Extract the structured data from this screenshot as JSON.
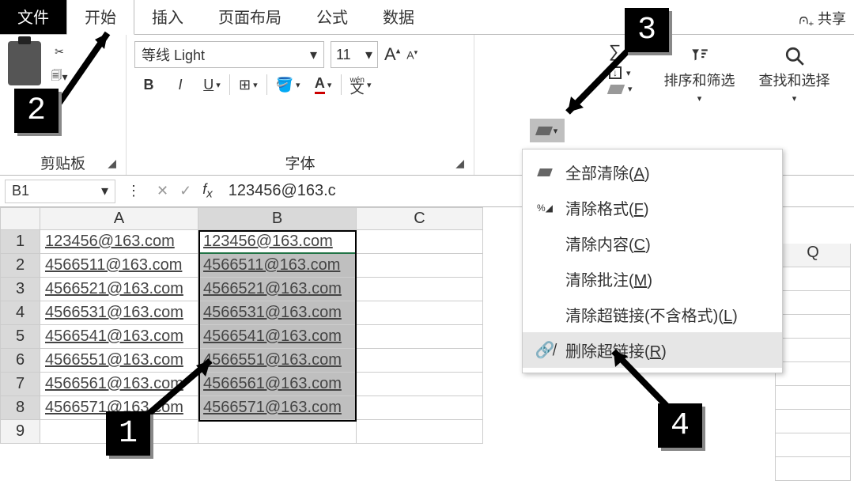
{
  "tabs": {
    "file": "文件",
    "home": "开始",
    "insert": "插入",
    "layout": "页面布局",
    "formulas": "公式",
    "data": "数据",
    "share": "共享"
  },
  "clipboard": {
    "label": "剪贴板"
  },
  "font": {
    "label": "字体",
    "name": "等线 Light",
    "size": "11",
    "bold": "B",
    "italic": "I",
    "underline": "U",
    "wen": "wén",
    "wen2": "文"
  },
  "editing": {
    "sort_filter": "排序和筛选",
    "find_select": "查找和选择"
  },
  "namebox": {
    "value": "B1"
  },
  "formula": {
    "value": "123456@163.c"
  },
  "columns": {
    "A": "A",
    "B": "B",
    "C": "C",
    "Q": "Q"
  },
  "rows": [
    {
      "n": "1",
      "a": "123456@163.com",
      "b": "123456@163.com"
    },
    {
      "n": "2",
      "a": "4566511@163.com",
      "b": "4566511@163.com"
    },
    {
      "n": "3",
      "a": "4566521@163.com",
      "b": "4566521@163.com"
    },
    {
      "n": "4",
      "a": "4566531@163.com",
      "b": "4566531@163.com"
    },
    {
      "n": "5",
      "a": "4566541@163.com",
      "b": "4566541@163.com"
    },
    {
      "n": "6",
      "a": "4566551@163.com",
      "b": "4566551@163.com"
    },
    {
      "n": "7",
      "a": "4566561@163.com",
      "b": "4566561@163.com"
    },
    {
      "n": "8",
      "a": "4566571@163.com",
      "b": "4566571@163.com"
    },
    {
      "n": "9",
      "a": "",
      "b": ""
    }
  ],
  "menu": {
    "clear_all": "全部清除(",
    "clear_all_k": "A",
    "close": ")",
    "clear_formats": "清除格式(",
    "clear_formats_k": "F",
    "clear_contents": "清除内容(",
    "clear_contents_k": "C",
    "clear_comments": "清除批注(",
    "clear_comments_k": "M",
    "clear_hyperlinks": "清除超链接(不含格式)(",
    "clear_hyperlinks_k": "L",
    "remove_hyperlinks": "删除超链接(",
    "remove_hyperlinks_k": "R"
  },
  "steps": {
    "s1": "1",
    "s2": "2",
    "s3": "3",
    "s4": "4"
  },
  "chart_data": null
}
